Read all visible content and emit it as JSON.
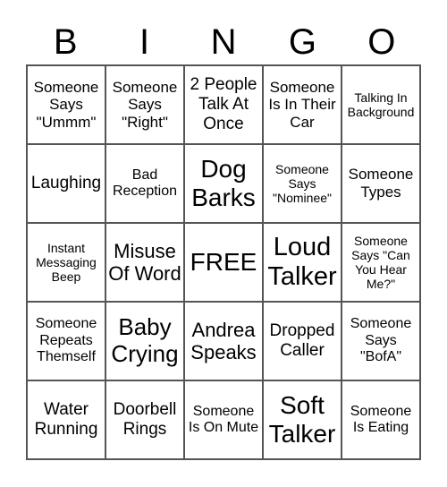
{
  "header": {
    "letters": [
      "B",
      "I",
      "N",
      "G",
      "O"
    ]
  },
  "cells": [
    [
      "Someone Says \"Ummm\"",
      "Someone Says \"Right\"",
      "2 People Talk At Once",
      "Someone Is In Their Car",
      "Talking In Background"
    ],
    [
      "Laughing",
      "Bad Reception",
      "Dog Barks",
      "Someone Says \"Nominee\"",
      "Someone Types"
    ],
    [
      "Instant Messaging Beep",
      "Misuse Of Word",
      "FREE",
      "Loud Talker",
      "Someone Says \"Can You Hear Me?\""
    ],
    [
      "Someone Repeats Themself",
      "Baby Crying",
      "Andrea Speaks",
      "Dropped Caller",
      "Someone Says \"BofA\""
    ],
    [
      "Water Running",
      "Doorbell Rings",
      "Someone Is On Mute",
      "Soft Talker",
      "Someone Is Eating"
    ]
  ]
}
